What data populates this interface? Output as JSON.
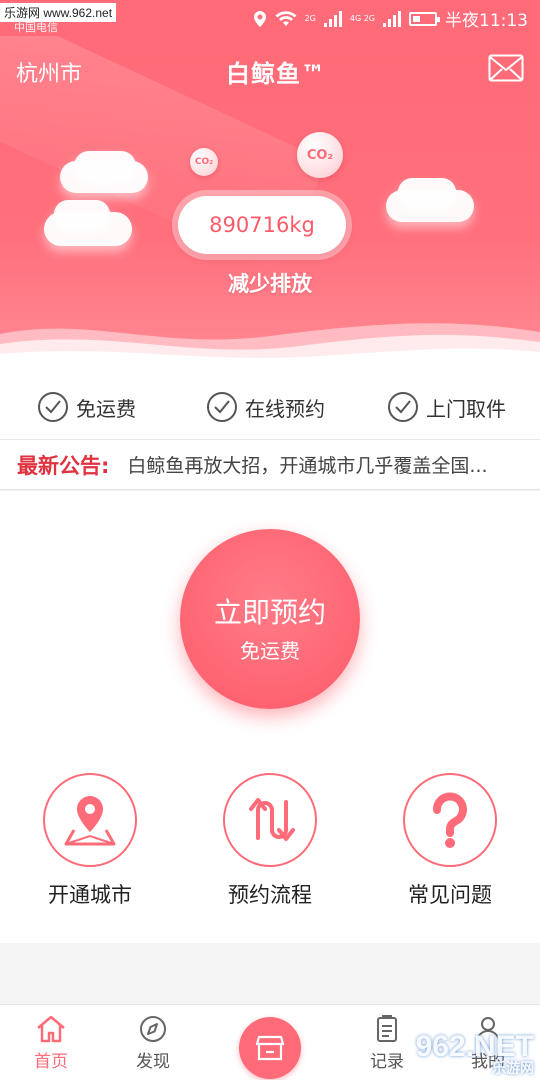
{
  "status_bar": {
    "watermark": "乐游网 www.962.net",
    "carrier": "中国电信",
    "time": "半夜11:13",
    "net_1": "2G",
    "net_2": "4G 2G"
  },
  "header": {
    "city": "杭州市",
    "logo": "白鲸鱼™"
  },
  "hero": {
    "co2_small": "CO₂",
    "co2_large": "CO₂",
    "emission_value": "890716kg",
    "emission_caption": "减少排放"
  },
  "features": [
    {
      "label": "免运费"
    },
    {
      "label": "在线预约"
    },
    {
      "label": "上门取件"
    }
  ],
  "notice": {
    "label": "最新公告:",
    "text": "白鲸鱼再放大招，开通城市几乎覆盖全国..."
  },
  "booking": {
    "title": "立即预约",
    "subtitle": "免运费"
  },
  "services": [
    {
      "label": "开通城市",
      "icon": "map-pin-icon"
    },
    {
      "label": "预约流程",
      "icon": "flow-arrows-icon"
    },
    {
      "label": "常见问题",
      "icon": "question-icon"
    }
  ],
  "tabs": [
    {
      "label": "首页",
      "active": true
    },
    {
      "label": "发现",
      "active": false
    },
    {
      "label": "记录",
      "active": false
    },
    {
      "label": "我的",
      "active": false
    }
  ],
  "bottom_watermark": {
    "main": "962.NET",
    "sub": "乐游网"
  },
  "colors": {
    "accent": "#ff6b78",
    "notice_red": "#e0323f"
  }
}
